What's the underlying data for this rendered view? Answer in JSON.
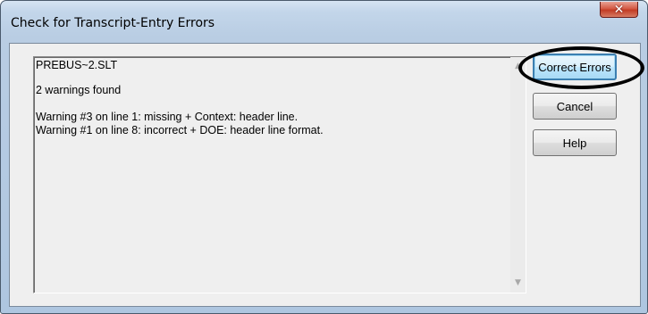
{
  "window": {
    "title": "Check for Transcript-Entry Errors",
    "close_icon": "close-icon"
  },
  "report": {
    "filename": "PREBUS~2.SLT",
    "summary": "2 warnings found",
    "warnings": [
      "Warning #3 on line 1: missing + Context: header line.",
      "Warning #1 on line 8: incorrect + DOE: header line format."
    ]
  },
  "buttons": {
    "correct_errors": "Correct Errors",
    "cancel": "Cancel",
    "help": "Help"
  },
  "colors": {
    "annotation_ring": "#000000",
    "default_button_border": "#3c7fb1",
    "close_button": "#c23c24"
  }
}
